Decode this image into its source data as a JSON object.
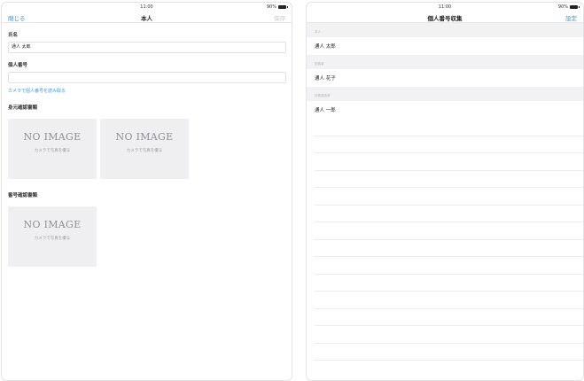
{
  "left": {
    "status": {
      "time": "11:00",
      "battery": "90%"
    },
    "nav": {
      "close": "閉じる",
      "title": "本人",
      "save": "保存"
    },
    "fields": {
      "name_label": "氏名",
      "name_value": "通人 太郎",
      "number_label": "個人番号",
      "number_value": "",
      "camera_link": "カメラで個人番号を読み取る"
    },
    "id_docs": {
      "label": "身元確認書類",
      "items": [
        {
          "placeholder": "NO IMAGE",
          "action": "カメラで写真を撮る"
        },
        {
          "placeholder": "NO IMAGE",
          "action": "カメラで写真を撮る"
        }
      ]
    },
    "number_docs": {
      "label": "番号確認書類",
      "items": [
        {
          "placeholder": "NO IMAGE",
          "action": "カメラで写真を撮る"
        }
      ]
    }
  },
  "right": {
    "status": {
      "time": "11:00",
      "battery": "90%"
    },
    "nav": {
      "title": "個人番号収集",
      "settings": "設定"
    },
    "groups": [
      {
        "header": "本人",
        "name": "通人 太郎"
      },
      {
        "header": "配偶者",
        "name": "通人 花子"
      },
      {
        "header": "扶養親族等",
        "name": "通人 一郎"
      }
    ]
  },
  "colors": {
    "accent": "#3f95d8",
    "disabled": "#c9c9cd",
    "placeholder_bg": "#efeff1"
  }
}
